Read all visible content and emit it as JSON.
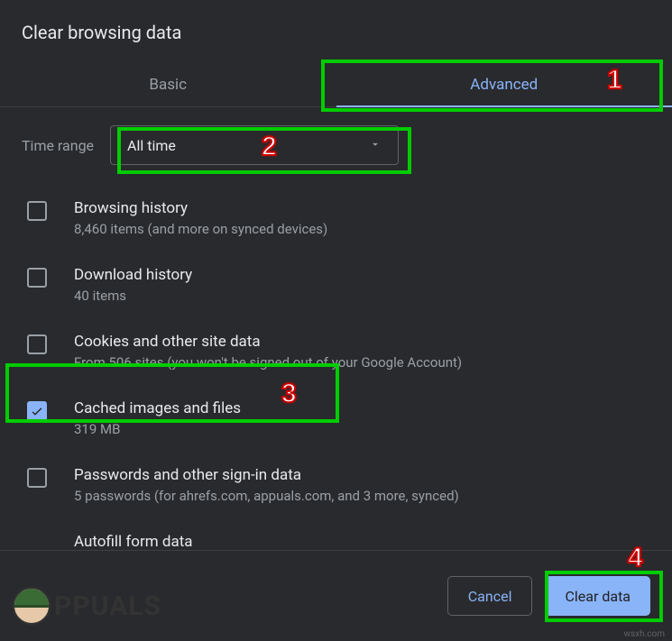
{
  "title": "Clear browsing data",
  "tabs": {
    "basic": "Basic",
    "advanced": "Advanced",
    "active": "advanced"
  },
  "time_range": {
    "label": "Time range",
    "value": "All time"
  },
  "options": {
    "browsing": {
      "title": "Browsing history",
      "sub": "8,460 items (and more on synced devices)",
      "checked": false
    },
    "download": {
      "title": "Download history",
      "sub": "40 items",
      "checked": false
    },
    "cookies": {
      "title": "Cookies and other site data",
      "sub": "From 506 sites (you won't be signed out of your Google Account)",
      "checked": false
    },
    "cache": {
      "title": "Cached images and files",
      "sub": "319 MB",
      "checked": true
    },
    "passwords": {
      "title": "Passwords and other sign-in data",
      "sub": "5 passwords (for ahrefs.com, appuals.com, and 3 more, synced)",
      "checked": false
    },
    "autofill": {
      "title": "Autofill form data",
      "sub": "",
      "checked": false
    }
  },
  "buttons": {
    "cancel": "Cancel",
    "clear": "Clear data"
  },
  "annotations": {
    "n1": "1",
    "n2": "2",
    "n3": "3",
    "n4": "4"
  },
  "branding": {
    "text": "PPUALS"
  },
  "watermark": "wsxh.com"
}
